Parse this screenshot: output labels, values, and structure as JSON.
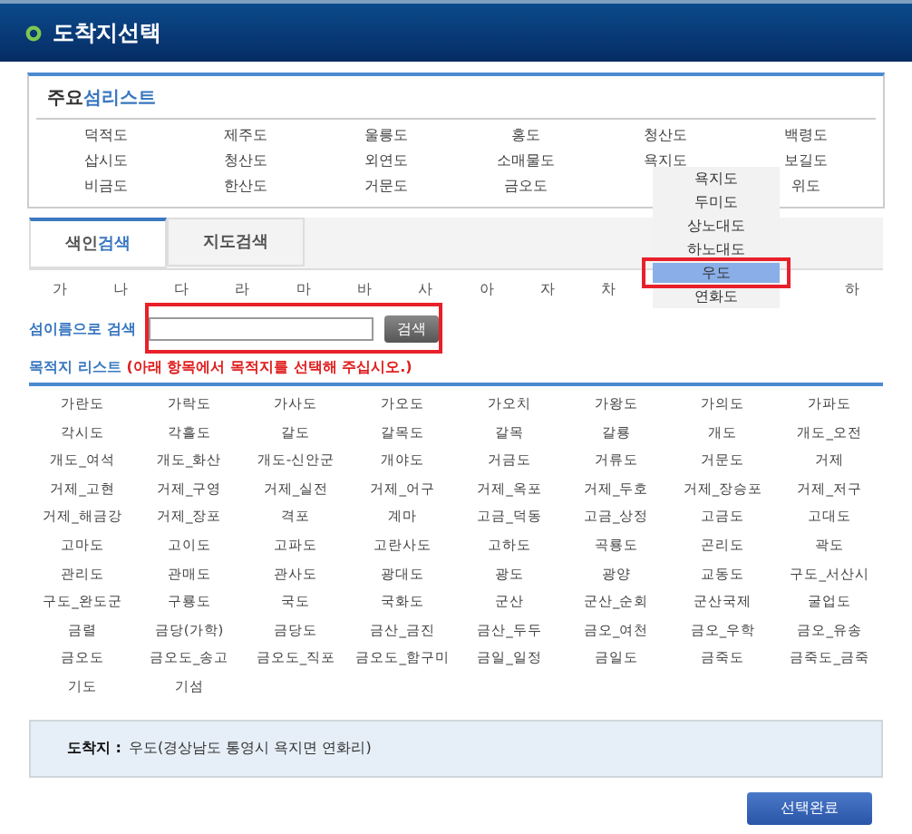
{
  "window": {
    "title": "도착지선택"
  },
  "main_islands": {
    "title_prefix": "주요",
    "title_rest": "섬리스트",
    "rows": [
      [
        "덕적도",
        "제주도",
        "울릉도",
        "홍도",
        "청산도",
        "백령도"
      ],
      [
        "삽시도",
        "청산도",
        "외연도",
        "소매물도",
        "욕지도",
        "보길도"
      ],
      [
        "비금도",
        "한산도",
        "거문도",
        "금오도",
        "",
        "위도"
      ]
    ]
  },
  "dropdown": {
    "items": [
      {
        "label": "욕지도",
        "selected": false
      },
      {
        "label": "두미도",
        "selected": false
      },
      {
        "label": "상노대도",
        "selected": false
      },
      {
        "label": "하노대도",
        "selected": false
      },
      {
        "label": "우도",
        "selected": true
      },
      {
        "label": "연화도",
        "selected": false
      }
    ]
  },
  "tabs": [
    {
      "label_prefix": "색인",
      "label_rest": "검색",
      "selected": true
    },
    {
      "label_prefix": "지도",
      "label_rest": "검색",
      "selected": false
    }
  ],
  "index_letters": [
    "가",
    "나",
    "다",
    "라",
    "마",
    "바",
    "사",
    "아",
    "자",
    "차",
    "하"
  ],
  "name_search": {
    "label": "섬이름으로 검색",
    "button": "검색"
  },
  "destination_list": {
    "title": "목적지 리스트",
    "hint": "(아래 항목에서 목적지를 선택해 주십시오.)",
    "items": [
      "가란도",
      "가락도",
      "가사도",
      "가오도",
      "가오치",
      "가왕도",
      "가의도",
      "가파도",
      "각시도",
      "각흘도",
      "갈도",
      "갈목도",
      "갈목",
      "갈룡",
      "개도",
      "개도_오전",
      "개도_여석",
      "개도_화산",
      "개도-신안군",
      "개야도",
      "거금도",
      "거류도",
      "거문도",
      "거제",
      "거제_고현",
      "거제_구영",
      "거제_실전",
      "거제_어구",
      "거제_옥포",
      "거제_두호",
      "거제_장승포",
      "거제_저구",
      "거제_해금강",
      "거제_장포",
      "격포",
      "계마",
      "고금_덕동",
      "고금_상정",
      "고금도",
      "고대도",
      "고마도",
      "고이도",
      "고파도",
      "고란사도",
      "고하도",
      "곡룡도",
      "곤리도",
      "곽도",
      "관리도",
      "관매도",
      "관사도",
      "광대도",
      "광도",
      "광양",
      "교동도",
      "구도_서산시",
      "구도_완도군",
      "구룡도",
      "국도",
      "국화도",
      "군산",
      "군산_순회",
      "군산국제",
      "굴업도",
      "금렬",
      "금당(가학)",
      "금당도",
      "금산_금진",
      "금산_두두",
      "금오_여천",
      "금오_우학",
      "금오_유송",
      "금오도",
      "금오도_송고",
      "금오도_직포",
      "금오도_함구미",
      "금일_일정",
      "금일도",
      "금죽도",
      "금죽도_금죽",
      "기도",
      "기섬"
    ]
  },
  "destination": {
    "label": "도착지 :",
    "value": "우도(경상남도 통영시 욕지면 연화리)"
  },
  "confirm_button": "선택완료"
}
